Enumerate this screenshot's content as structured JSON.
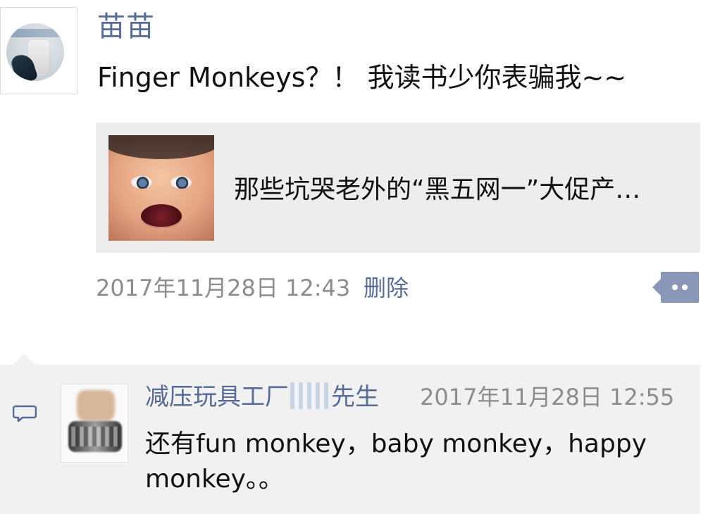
{
  "post": {
    "username": "苗苗",
    "text": "Finger Monkeys？！ 我读书少你表骗我~~",
    "link": {
      "title": "那些坑哭老外的“黑五网一”大促产…"
    },
    "timestamp": "2017年11月28日 12:43",
    "delete_label": "删除"
  },
  "comments": [
    {
      "name_prefix": "减压玩具工厂",
      "name_suffix": "先生",
      "time": "2017年11月28日 12:55",
      "text": "还有fun monkey，baby monkey，happy monkey。。"
    }
  ],
  "colors": {
    "link_blue": "#576b95",
    "meta_gray": "#8c8c8c",
    "card_bg": "#ededed",
    "comment_bg": "#f1f1f1",
    "more_button_bg": "#8a97b6"
  },
  "icons": {
    "more": "more-dots-icon",
    "comment": "comment-bubble-icon"
  }
}
